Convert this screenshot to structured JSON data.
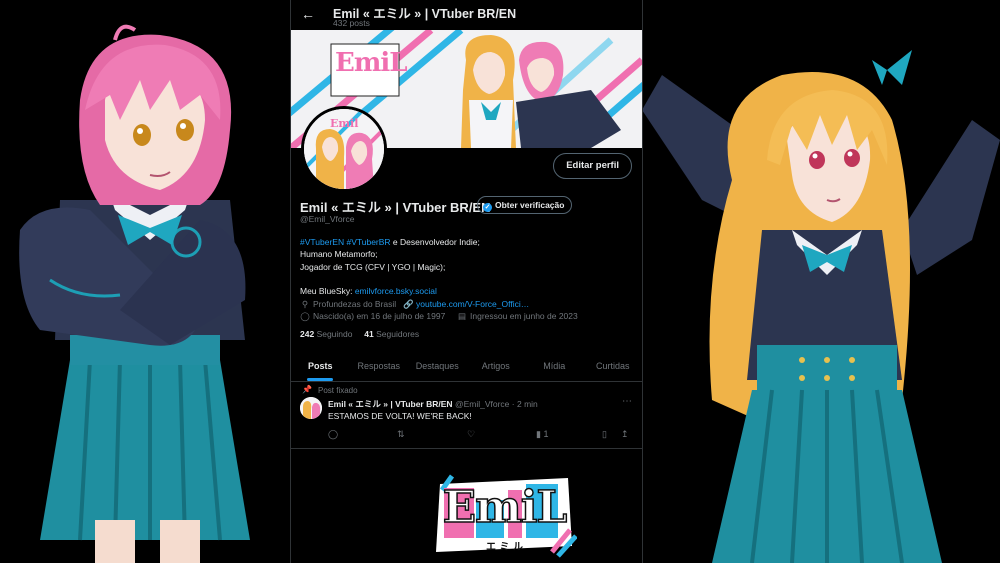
{
  "header": {
    "back_icon": "arrow-left-icon",
    "title": "Emil « エミル » | VTuber BR/EN",
    "posts_count": "432 posts"
  },
  "banner": {
    "logo_text": "EmiL"
  },
  "profile": {
    "edit_button": "Editar perfil",
    "name": "Emil « エミル » | VTuber BR/EN",
    "verify_button": "Obter verificação",
    "handle": "@Emil_Vforce",
    "bio": {
      "hashtag1": "#VTuberEN",
      "hashtag2": "#VTuberBR",
      "line1_rest": " e Desenvolvedor Indie;",
      "line2": "Humano Metamorfo;",
      "line3": "Jogador de TCG (CFV | YGO | Magic);",
      "line5_prefix": "Meu BlueSky: ",
      "bluesky_link": "emilvforce.bsky.social"
    },
    "location": "Profundezas do Brasil",
    "website": "youtube.com/V-Force_Offici…",
    "birthday": "Nascido(a) em 16 de julho de 1997",
    "joined": "Ingressou em junho de 2023",
    "following_count": "242",
    "following_label": "Seguindo",
    "followers_count": "41",
    "followers_label": "Seguidores"
  },
  "tabs": [
    {
      "label": "Posts",
      "active": true
    },
    {
      "label": "Respostas",
      "active": false
    },
    {
      "label": "Destaques",
      "active": false
    },
    {
      "label": "Artigos",
      "active": false
    },
    {
      "label": "Mídia",
      "active": false
    },
    {
      "label": "Curtidas",
      "active": false
    }
  ],
  "pinned_post": {
    "pinned_label": "Post fixado",
    "author": "Emil « エミル » | VTuber BR/EN",
    "handle": "@Emil_Vforce",
    "separator": "·",
    "time": "2 min",
    "text": "ESTAMOS DE VOLTA! WE'RE BACK!",
    "views": "1"
  },
  "bottom_logo": {
    "text": "EmiL",
    "subtext": "エ ミ ル"
  },
  "colors": {
    "accent": "#1d9bf0",
    "background": "#000000",
    "muted": "#71767b",
    "logo_pink": "#f06fb0",
    "logo_blue": "#2fb6e6"
  }
}
